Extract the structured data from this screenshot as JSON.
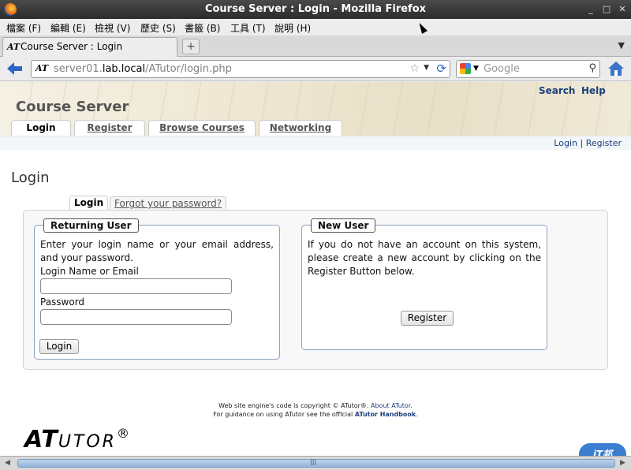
{
  "window": {
    "title": "Course Server : Login - Mozilla Firefox",
    "controls": [
      "_",
      "□",
      "✕"
    ]
  },
  "menubar": [
    {
      "label": "檔案 (F)"
    },
    {
      "label": "編輯 (E)"
    },
    {
      "label": "檢視 (V)"
    },
    {
      "label": "歷史 (S)"
    },
    {
      "label": "書籤 (B)"
    },
    {
      "label": "工具 (T)"
    },
    {
      "label": "說明 (H)"
    }
  ],
  "tabs": [
    {
      "favicon": "AT",
      "label": "Course Server : Login",
      "active": true
    }
  ],
  "newtab_label": "+",
  "navbar": {
    "site_icon": "AT",
    "url_host": "server01.lab.local",
    "url_domain_bold": "lab.local",
    "url_prefix": "server01.",
    "url_path": "/ATutor/login.php",
    "search_engine": "google-icon",
    "search_placeholder": "Google"
  },
  "site": {
    "title": "Course Server",
    "top_links": [
      {
        "label": "Search"
      },
      {
        "label": "Help"
      }
    ],
    "nav_tabs": [
      {
        "label": "Login",
        "active": true
      },
      {
        "label": "Register",
        "active": false
      },
      {
        "label": "Browse Courses",
        "active": false
      },
      {
        "label": "Networking",
        "active": false
      }
    ],
    "user_links": {
      "login": "Login",
      "sep": "|",
      "register": "Register"
    }
  },
  "main": {
    "page_title": "Login",
    "login_tabs": [
      {
        "label": "Login",
        "active": true
      },
      {
        "label": "Forgot your password?",
        "active": false
      }
    ],
    "returning_user": {
      "legend": "Returning User",
      "intro": "Enter your login name or your email address, and your password.",
      "login_label": "Login Name or Email",
      "login_value": "",
      "password_label": "Password",
      "password_value": "",
      "submit_label": "Login"
    },
    "new_user": {
      "legend": "New User",
      "intro": "If you do not have an account on this system, please create a new account by clicking on the Register Button below.",
      "register_label": "Register"
    }
  },
  "footer": {
    "line1_prefix": "Web site engine's code is copyright © ATutor®.",
    "line1_link": "About ATutor",
    "line1_suffix": ".",
    "line2_prefix": "For guidance on using ATutor see the official",
    "line2_link": "ATutor Handbook",
    "line2_suffix": "."
  },
  "logo": {
    "big": "AT",
    "small": "UTOR",
    "reg": "®"
  },
  "badge": "iT邦"
}
